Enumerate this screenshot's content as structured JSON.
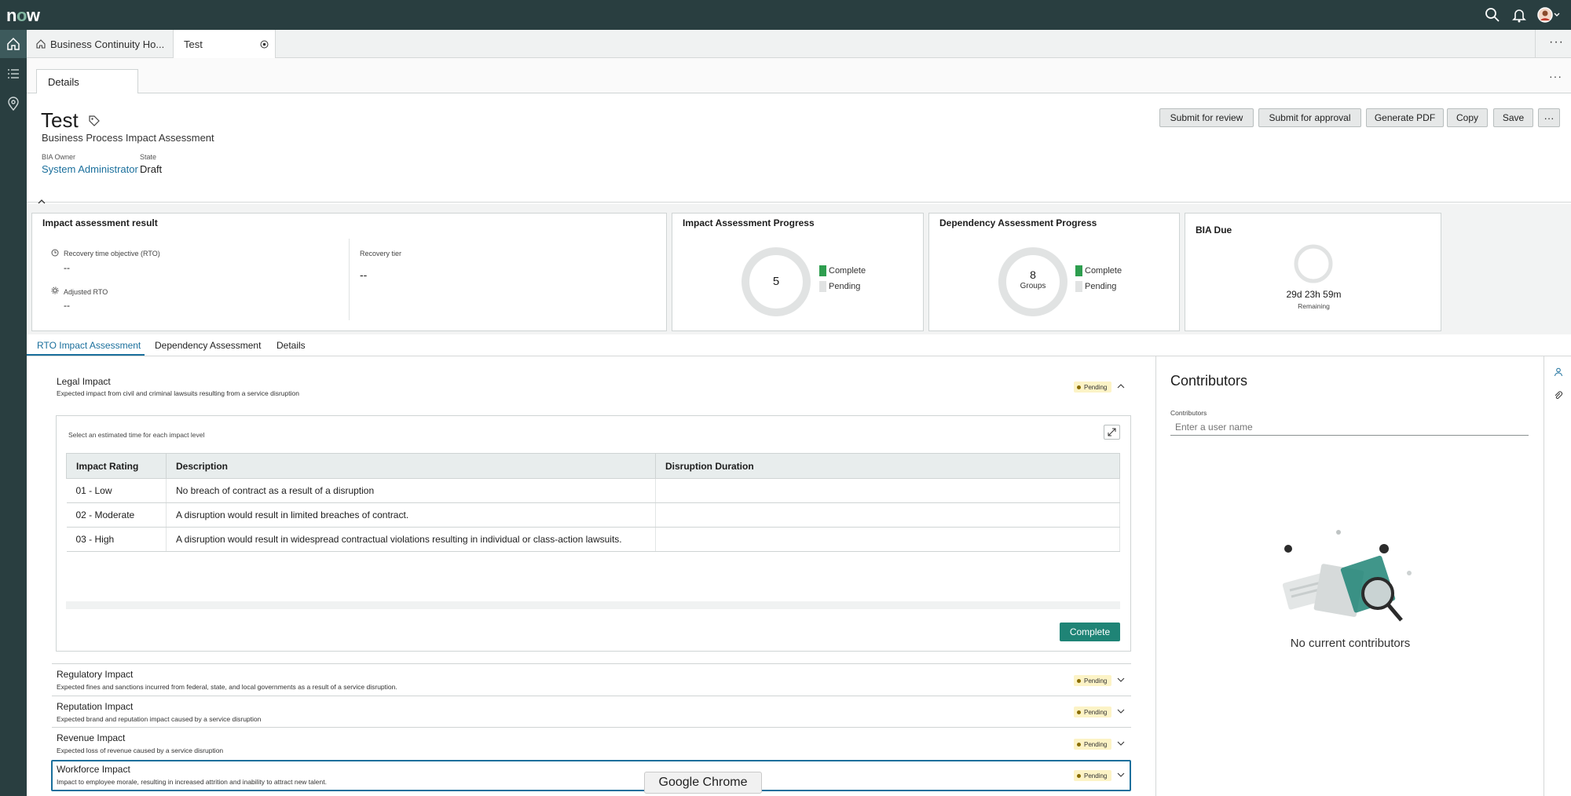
{
  "app": {
    "logo_prefix": "n",
    "logo_o": "o",
    "logo_suffix": "w"
  },
  "tabs": [
    {
      "label": "Business Continuity Ho..."
    },
    {
      "label": "Test"
    }
  ],
  "subtab": {
    "label": "Details"
  },
  "record": {
    "title": "Test",
    "subtitle": "Business Process Impact Assessment",
    "owner_label": "BIA Owner",
    "owner_value": "System Administrator",
    "state_label": "State",
    "state_value": "Draft"
  },
  "actions": {
    "submit_review": "Submit for review",
    "submit_approval": "Submit for approval",
    "generate_pdf": "Generate PDF",
    "copy": "Copy",
    "save": "Save"
  },
  "cards": {
    "impact_result": {
      "title": "Impact assessment result",
      "rto_label": "Recovery time objective (RTO)",
      "rto_value": "--",
      "adj_label": "Adjusted RTO",
      "adj_value": "--",
      "tier_label": "Recovery tier",
      "tier_value": "--"
    },
    "impact_progress": {
      "title": "Impact Assessment Progress",
      "center": "5",
      "complete": "Complete",
      "pending": "Pending"
    },
    "dependency_progress": {
      "title": "Dependency Assessment Progress",
      "center": "8",
      "center_sub": "Groups",
      "complete": "Complete",
      "pending": "Pending"
    },
    "bia_due": {
      "title": "BIA Due",
      "value": "29d 23h 59m",
      "sub": "Remaining"
    }
  },
  "assessment_tabs": [
    "RTO Impact Assessment",
    "Dependency Assessment",
    "Details"
  ],
  "impacts": [
    {
      "title": "Legal Impact",
      "desc": "Expected impact from civil and criminal lawsuits resulting from a service disruption",
      "status": "Pending"
    },
    {
      "title": "Regulatory Impact",
      "desc": "Expected fines and sanctions incurred from federal, state, and local governments as a result of a service disruption.",
      "status": "Pending"
    },
    {
      "title": "Reputation Impact",
      "desc": "Expected brand and reputation impact caused by a service disruption",
      "status": "Pending"
    },
    {
      "title": "Revenue Impact",
      "desc": "Expected loss of revenue caused by a service disruption",
      "status": "Pending"
    },
    {
      "title": "Workforce Impact",
      "desc": "Impact to employee morale, resulting in increased attrition and inability to attract new talent.",
      "status": "Pending"
    }
  ],
  "legal_table": {
    "instruction": "Select an estimated time for each impact level",
    "headers": [
      "Impact Rating",
      "Description",
      "Disruption Duration"
    ],
    "rows": [
      [
        "01 - Low",
        "No breach of contract as a result of a disruption",
        ""
      ],
      [
        "02 - Moderate",
        "A disruption would result in limited breaches of contract.",
        ""
      ],
      [
        "03 - High",
        "A disruption would result in widespread contractual violations resulting in individual or class-action lawsuits.",
        ""
      ]
    ],
    "complete_button": "Complete"
  },
  "contributors": {
    "title": "Contributors",
    "field_label": "Contributors",
    "placeholder": "Enter a user name",
    "empty": "No current contributors"
  },
  "overlay": {
    "label": "Google Chrome"
  },
  "colors": {
    "topbar": "#293e40",
    "accent": "#1f8476",
    "complete": "#2e9e4f",
    "pending_badge": "#fcf3c6"
  }
}
